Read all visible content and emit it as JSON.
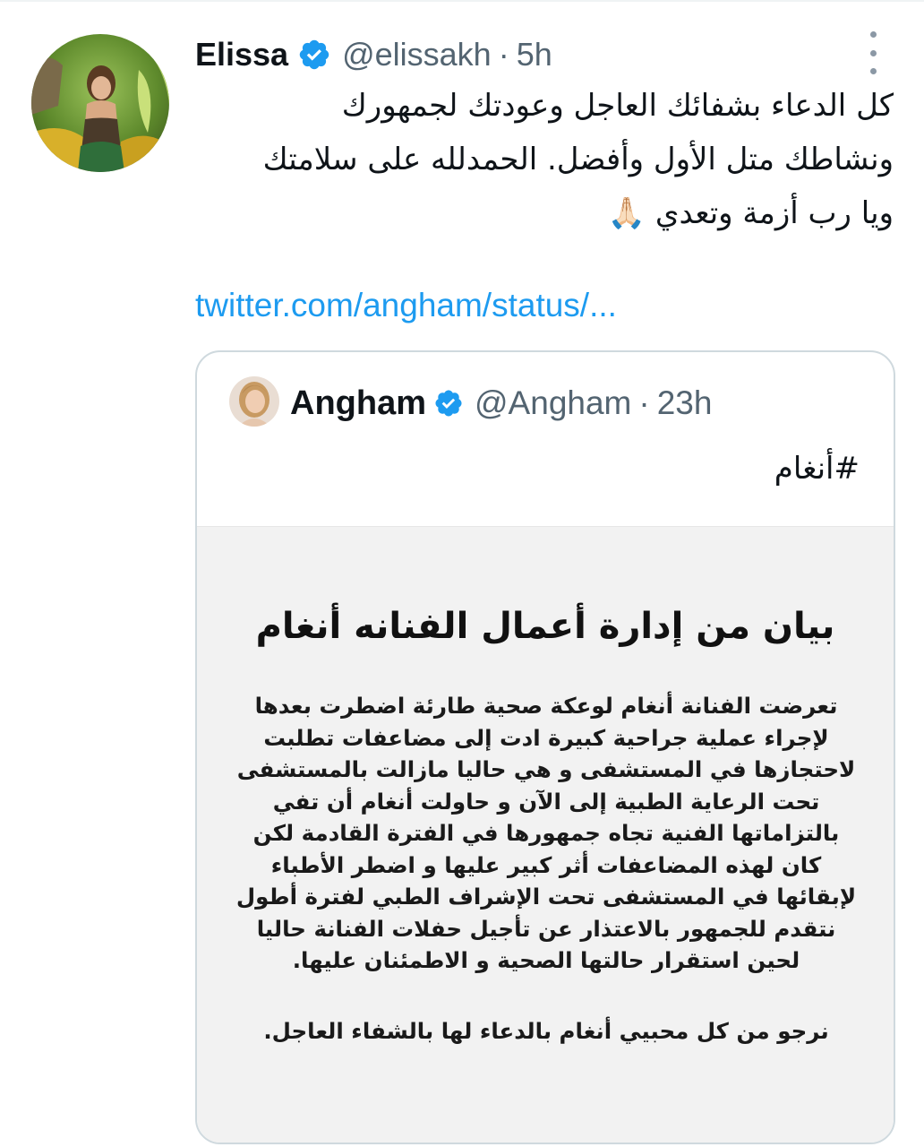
{
  "tweet": {
    "author_name": "Elissa",
    "author_handle": "@elissakh",
    "separator": "·",
    "time": "5h",
    "text": "كل الدعاء بشفائك العاجل وعودتك لجمهورك\nونشاطك متل الأول وأفضل. الحمدلله على سلامتك\nويا رب أزمة وتعدي 🙏🏻",
    "link": "twitter.com/angham/status/..."
  },
  "quoted_tweet": {
    "author_name": "Angham",
    "author_handle": "@Angham",
    "separator": "·",
    "time": "23h",
    "text": "#أنغام",
    "image": {
      "title": "بيان من إدارة أعمال الفنانه أنغام",
      "lines": [
        "تعرضت الفنانة أنغام لوعكة صحية طارئة اضطرت بعدها",
        "لإجراء عملية جراحية كبيرة ادت إلى مضاعفات تطلبت",
        "لاحتجازها في المستشفى و هي حاليا مازالت بالمستشفى",
        "تحت الرعاية الطبية إلى الآن و حاولت أنغام أن تفي",
        "بالتزاماتها الفنية تجاه جمهورها في الفترة القادمة لكن",
        "كان لهذه المضاعفات أثر كبير عليها و اضطر الأطباء",
        "لإبقائها في المستشفى تحت الإشراف الطبي لفترة أطول",
        "نتقدم للجمهور بالاعتذار عن تأجيل حفلات الفنانة حاليا",
        "لحين استقرار حالتها الصحية و الاطمئنان عليها."
      ],
      "closing": "نرجو من كل محبيي أنغام بالدعاء لها بالشفاء العاجل."
    }
  },
  "icons": {
    "verified": "verified-badge-icon",
    "more": "more-options-icon"
  },
  "colors": {
    "link": "#1d9bf0",
    "verified": "#1d9bf0",
    "secondary_text": "#536471",
    "border": "#cfd9de"
  }
}
